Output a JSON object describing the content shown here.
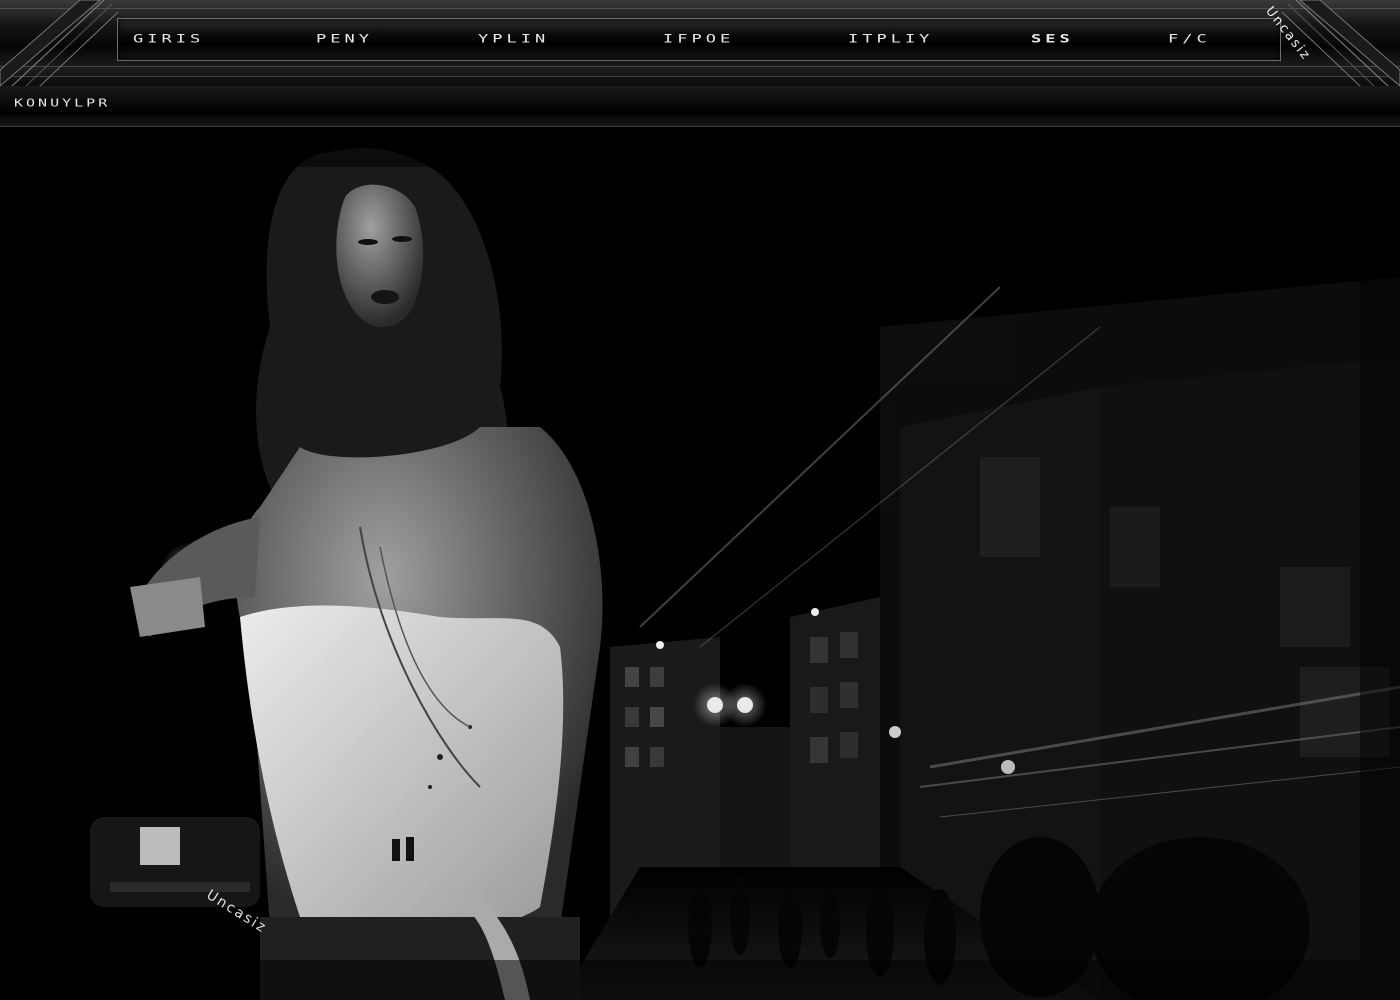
{
  "nav": {
    "items": [
      {
        "label": "GIRIS"
      },
      {
        "label": "PENY"
      },
      {
        "label": "YPLIN"
      },
      {
        "label": "IFPOE"
      },
      {
        "label": "ITPLIY"
      },
      {
        "label": "SES"
      },
      {
        "label": "F/C"
      }
    ]
  },
  "brand": {
    "corner_signature": "Uncasiz",
    "scene_watermark": "Uncasiz"
  },
  "sub_bar": {
    "title": "KONUYLPR"
  }
}
